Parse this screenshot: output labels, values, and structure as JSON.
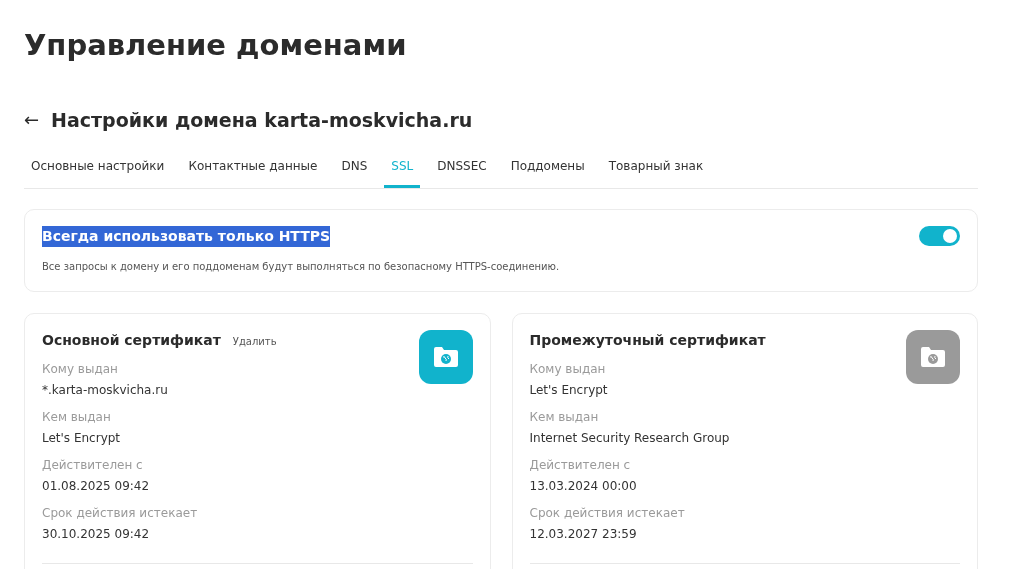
{
  "page_title": "Управление доменами",
  "back_arrow": "←",
  "domain_title": "Настройки домена karta-moskvicha.ru",
  "tabs": [
    {
      "label": "Основные настройки",
      "selected": false
    },
    {
      "label": "Контактные данные",
      "selected": false
    },
    {
      "label": "DNS",
      "selected": false
    },
    {
      "label": "SSL",
      "selected": true
    },
    {
      "label": "DNSSEC",
      "selected": false
    },
    {
      "label": "Поддомены",
      "selected": false
    },
    {
      "label": "Товарный знак",
      "selected": false
    }
  ],
  "https_setting": {
    "title": "Всегда использовать только HTTPS",
    "title_highlighted": true,
    "description": "Все запросы к домену и его поддоменам будут выполняться по безопасному HTTPS-соединению.",
    "on": true
  },
  "certificates": [
    {
      "title": "Основной сертификат",
      "action": "Удалить",
      "color": "#11b3cc",
      "fields": [
        {
          "label": "Кому выдан",
          "value": "*.karta-moskvicha.ru"
        },
        {
          "label": "Кем выдан",
          "value": "Let's Encrypt"
        },
        {
          "label": "Действителен с",
          "value": "01.08.2025 09:42"
        },
        {
          "label": "Срок действия истекает",
          "value": "30.10.2025 09:42"
        }
      ]
    },
    {
      "title": "Промежуточный сертификат",
      "color": "#9a9a9a",
      "fields": [
        {
          "label": "Кому выдан",
          "value": "Let's Encrypt"
        },
        {
          "label": "Кем выдан",
          "value": "Internet Security Research Group"
        },
        {
          "label": "Действителен с",
          "value": "13.03.2024 00:00"
        },
        {
          "label": "Срок действия истекает",
          "value": "12.03.2027 23:59"
        }
      ]
    }
  ]
}
